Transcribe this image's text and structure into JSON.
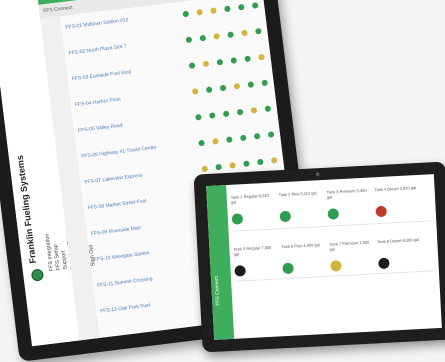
{
  "dashboard": {
    "brand": "Franklin Fueling Systems",
    "nav": [
      "FFS Integration",
      "FFS Setup",
      "Support",
      "Inventory Status",
      "FFS Connect Configuration",
      "My Account Users",
      "Sign Out"
    ],
    "subtitle": "FFS Connect",
    "rows": [
      {
        "link": "FFS-01 Midtown Station #12",
        "dots": [
          "green",
          "gold",
          "gold",
          "green",
          "green",
          "green"
        ]
      },
      {
        "link": "FFS-02 North Plaza Site 7",
        "dots": [
          "green",
          "green",
          "gold",
          "green",
          "gold",
          "green"
        ]
      },
      {
        "link": "FFS-03 Eastside Fuel Stop",
        "dots": [
          "green",
          "gold",
          "green",
          "green",
          "green",
          "gold"
        ]
      },
      {
        "link": "FFS-04 Harbor Point",
        "dots": [
          "gold",
          "green",
          "green",
          "gold",
          "green",
          "green"
        ]
      },
      {
        "link": "FFS-05 Valley Road",
        "dots": [
          "green",
          "green",
          "green",
          "green",
          "gold",
          "green"
        ]
      },
      {
        "link": "FFS-06 Highway 41 Travel Center",
        "dots": [
          "green",
          "gold",
          "green",
          "green",
          "green",
          "green"
        ]
      },
      {
        "link": "FFS-07 Lakeview Express",
        "dots": [
          "gold",
          "green",
          "gold",
          "green",
          "green",
          "gold"
        ]
      },
      {
        "link": "FFS-08 Market Street Fuel",
        "dots": [
          "green",
          "green",
          "green",
          "gold",
          "green",
          "green"
        ]
      },
      {
        "link": "FFS-09 Riverside Mart",
        "dots": [
          "green",
          "gold",
          "green",
          "green",
          "gold",
          "green"
        ]
      },
      {
        "link": "FFS-10 Westgate Station",
        "dots": [
          "green",
          "green",
          "gold",
          "green",
          "green",
          "green"
        ]
      },
      {
        "link": "FFS-11 Summit Crossing",
        "dots": [
          "gold",
          "green",
          "green",
          "green",
          "green",
          "gold"
        ]
      },
      {
        "link": "FFS-12 Oak Park Fuel",
        "dots": [
          "green",
          "green",
          "green",
          "green",
          "green",
          "green"
        ]
      }
    ]
  },
  "tablet": {
    "title": "FFS Connect",
    "cards": [
      {
        "text": "Tank 1 Regular 8,240 gal",
        "color": "green"
      },
      {
        "text": "Tank 2 Plus 5,112 gal",
        "color": "green"
      },
      {
        "text": "Tank 3 Premium 3,450 gal",
        "color": "green"
      },
      {
        "text": "Tank 4 Diesel 2,020 gal",
        "color": "red"
      },
      {
        "text": "Tank 5 Regular 7,800 gal",
        "color": "dark"
      },
      {
        "text": "Tank 6 Plus 4,400 gal",
        "color": "green"
      },
      {
        "text": "Tank 7 Premium 1,900 gal",
        "color": "gold"
      },
      {
        "text": "Tank 8 Diesel 6,300 gal",
        "color": "dark"
      }
    ]
  },
  "colors": {
    "green": "#2f9e4f",
    "gold": "#d6b33c",
    "red": "#c0392b",
    "dark": "#1c1c1c",
    "link": "#4b7fc4"
  }
}
